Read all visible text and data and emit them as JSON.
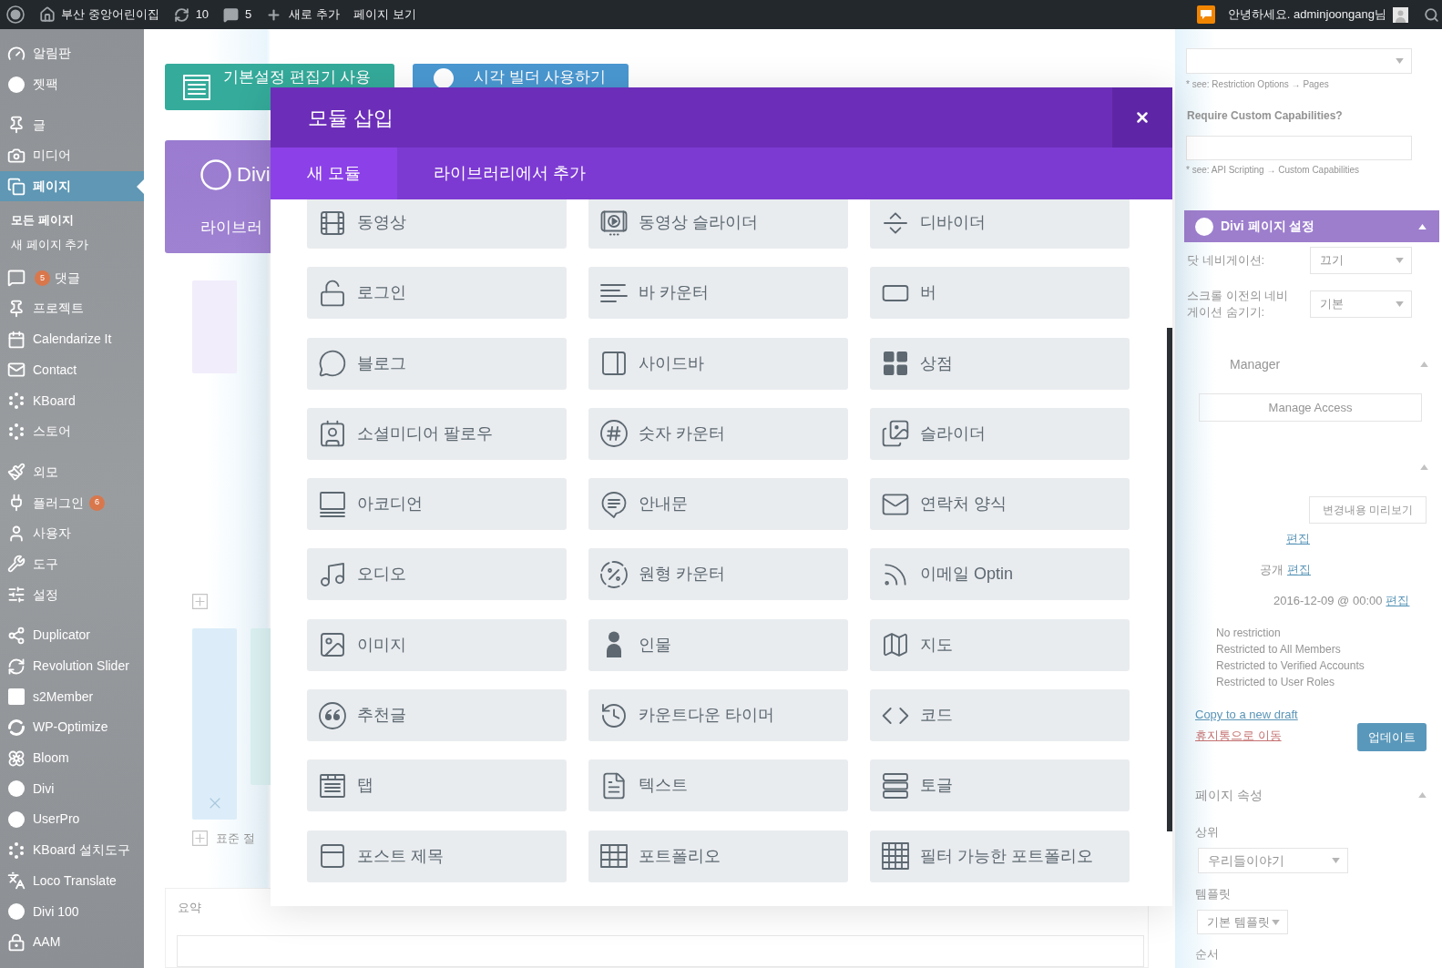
{
  "admin_bar": {
    "site_name": "부산 중앙어린이집",
    "updates": "10",
    "comments": "5",
    "new_item": "새로 추가",
    "view_page": "페이지 보기",
    "greeting": "안녕하세요. adminjoongang님"
  },
  "sidebar": {
    "groups": [
      [
        {
          "label": "알림판",
          "selected": false
        },
        {
          "label": "젯팩",
          "selected": false
        }
      ],
      [
        {
          "label": "글",
          "selected": false
        },
        {
          "label": "미디어",
          "selected": false
        },
        {
          "label": "페이지",
          "selected": true,
          "children": [
            {
              "label": "모든 페이지",
              "selected": true
            },
            {
              "label": "새 페이지 추가",
              "selected": false
            }
          ]
        },
        {
          "label": "댓글",
          "selected": false,
          "lead_badge": "5"
        },
        {
          "label": "프로젝트",
          "selected": false
        },
        {
          "label": "Calendarize It",
          "selected": false
        },
        {
          "label": "Contact",
          "selected": false
        },
        {
          "label": "KBoard",
          "selected": false
        },
        {
          "label": "스토어",
          "selected": false
        }
      ],
      [
        {
          "label": "외모",
          "selected": false
        },
        {
          "label": "플러그인",
          "selected": false,
          "badge": "6"
        },
        {
          "label": "사용자",
          "selected": false
        },
        {
          "label": "도구",
          "selected": false
        },
        {
          "label": "설정",
          "selected": false
        }
      ],
      [
        {
          "label": "Duplicator",
          "selected": false
        },
        {
          "label": "Revolution Slider",
          "selected": false
        },
        {
          "label": "s2Member",
          "selected": false
        },
        {
          "label": "WP-Optimize",
          "selected": false
        },
        {
          "label": "Bloom",
          "selected": false
        },
        {
          "label": "Divi",
          "selected": false
        },
        {
          "label": "UserPro",
          "selected": false
        },
        {
          "label": "KBoard 설치도구",
          "selected": false
        },
        {
          "label": "Loco Translate",
          "selected": false
        },
        {
          "label": "Divi 100",
          "selected": false
        },
        {
          "label": "AAM",
          "selected": false
        }
      ]
    ]
  },
  "main": {
    "editor_buttons": [
      {
        "label": "기본설정 편집기 사용",
        "kind": "classic"
      },
      {
        "label": "시각 빌더 사용하기",
        "kind": "builder"
      }
    ],
    "divi_panel": {
      "title": "Divi",
      "subtitle": "라이브러"
    },
    "row_add": "표준 절",
    "excerpt": "요약"
  },
  "right_panel": {
    "restriction_note": "* see: Restriction Options → Pages",
    "capabilities_label": "Require Custom Capabilities?",
    "capabilities_note": "* see: API Scripting → Custom Capabilities",
    "divi_settings": {
      "title": "Divi 페이지 설정",
      "fields": [
        {
          "label": "닷 네비게이션:",
          "value": "끄기"
        },
        {
          "label": "스크롤 이전의 네비게이션 숨기기:",
          "value": "기본"
        }
      ]
    },
    "access_manager": {
      "title": "Manager",
      "button": "Manage Access"
    },
    "publish": {
      "preview_button": "변경내용 미리보기",
      "rows": [
        {
          "link": "편집"
        },
        {
          "value": "공개",
          "link": "편집"
        },
        {
          "value": "2016-12-09 @ 00:00",
          "link": "편집"
        }
      ],
      "restrictions": [
        "No restriction",
        "Restricted to All Members",
        "Restricted to Verified Accounts",
        "Restricted to User Roles"
      ],
      "copy_link": "Copy to a new draft",
      "trash_link": "휴지통으로 이동",
      "update_button": "업데이트"
    },
    "page_attributes": {
      "title": "페이지 속성",
      "parent_label": "상위",
      "parent_value": "우리들이야기",
      "template_label": "템플릿",
      "template_value": "기본 템플릿",
      "order_label": "순서"
    }
  },
  "modal": {
    "title": "모듈 삽입",
    "tabs": [
      {
        "label": "새 모듈",
        "selected": true
      },
      {
        "label": "라이브러리에서 추가",
        "selected": false
      }
    ],
    "modules": [
      "동영상",
      "동영상 슬라이더",
      "디바이더",
      "로그인",
      "바 카운터",
      "버",
      "블로그",
      "사이드바",
      "상점",
      "소셜미디어 팔로우",
      "숫자 카운터",
      "슬라이더",
      "아코디언",
      "안내문",
      "연락처 양식",
      "오디오",
      "원형 카운터",
      "이메일 Optin",
      "이미지",
      "인물",
      "지도",
      "추천글",
      "카운트다운 타이머",
      "코드",
      "탭",
      "텍스트",
      "토글",
      "포스트 제목",
      "포트폴리오",
      "필터 가능한 포트폴리오"
    ]
  }
}
